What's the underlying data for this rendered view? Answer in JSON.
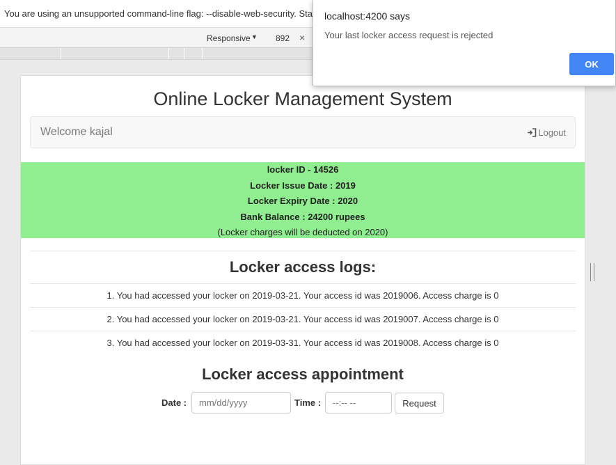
{
  "browser": {
    "infobar_text": "You are using an unsupported command-line flag: --disable-web-security. Sta",
    "device_mode": "Responsive",
    "viewport_width": "892",
    "close_symbol": "×"
  },
  "app": {
    "title": "Online Locker Management System",
    "welcome": "Welcome kajal",
    "logout_label": "Logout"
  },
  "locker": {
    "id_line": "locker ID - 14526",
    "issue_line": "Locker Issue Date : 2019",
    "expiry_line": "Locker Expiry Date : 2020",
    "balance_line": "Bank Balance : 24200 rupees",
    "charges_note": "(Locker charges will be deducted on 2020)"
  },
  "logs": {
    "title": "Locker access logs:",
    "items": [
      "1. You had accessed your locker on 2019-03-21. Your access id was 2019006. Access charge is 0",
      "2. You had accessed your locker on 2019-03-21. Your access id was 2019007. Access charge is 0",
      "3. You had accessed your locker on 2019-03-31. Your access id was 2019008. Access charge is 0"
    ]
  },
  "appointment": {
    "title": "Locker access appointment",
    "date_label": "Date :",
    "date_placeholder": "mm/dd/yyyy",
    "time_label": "Time :",
    "time_placeholder": "--:-- --",
    "request_label": "Request"
  },
  "dialog": {
    "title": "localhost:4200 says",
    "message": "Your last locker access request is rejected",
    "ok_label": "OK"
  },
  "colors": {
    "info_panel": "#90ee90",
    "ok_button": "#4285f4"
  }
}
